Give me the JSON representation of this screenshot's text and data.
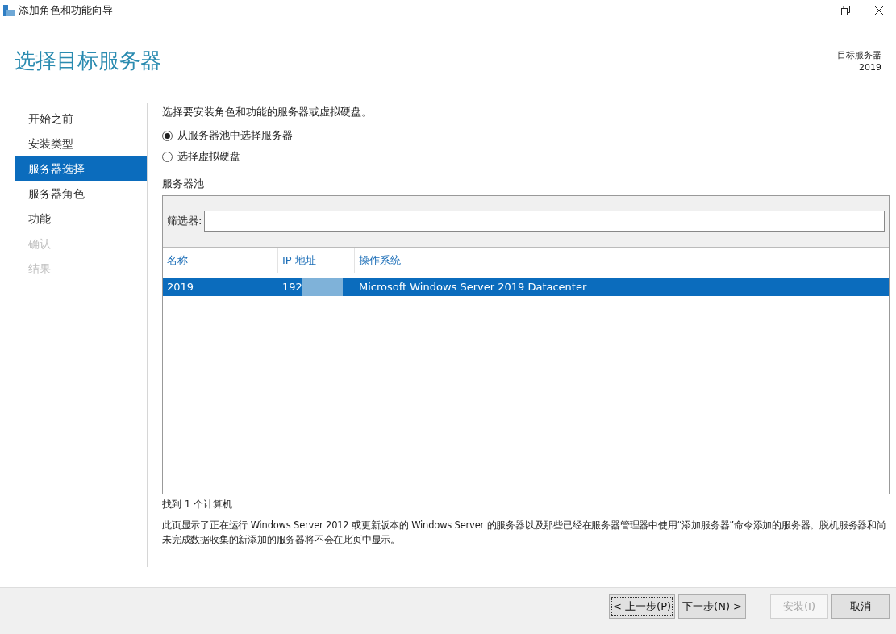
{
  "window": {
    "title": "添加角色和功能向导"
  },
  "header": {
    "title": "选择目标服务器",
    "target_label": "目标服务器",
    "target_value": "2019"
  },
  "sidebar": {
    "items": [
      {
        "label": "开始之前",
        "selected": false,
        "disabled": false
      },
      {
        "label": "安装类型",
        "selected": false,
        "disabled": false
      },
      {
        "label": "服务器选择",
        "selected": true,
        "disabled": false
      },
      {
        "label": "服务器角色",
        "selected": false,
        "disabled": false
      },
      {
        "label": "功能",
        "selected": false,
        "disabled": false
      },
      {
        "label": "确认",
        "selected": false,
        "disabled": true
      },
      {
        "label": "结果",
        "selected": false,
        "disabled": true
      }
    ]
  },
  "intro": "选择要安装角色和功能的服务器或虚拟硬盘。",
  "options": [
    {
      "label": "从服务器池中选择服务器",
      "selected": true
    },
    {
      "label": "选择虚拟硬盘",
      "selected": false
    }
  ],
  "pool": {
    "title": "服务器池",
    "filter_label": "筛选器:",
    "table": {
      "columns": [
        "名称",
        "IP 地址",
        "操作系统"
      ],
      "rows": [
        {
          "cells": [
            "2019",
            "192",
            "Microsoft Windows Server 2019 Datacenter"
          ],
          "selected": true,
          "ip_redacted": true
        }
      ]
    }
  },
  "count": "找到 1 个计算机",
  "note": "此页显示了正在运行 Windows Server 2012 或更新版本的 Windows Server 的服务器以及那些已经在服务器管理器中使用“添加服务器”命令添加的服务器。脱机服务器和尚未完成数据收集的新添加的服务器将不会在此页中显示。",
  "buttons": [
    {
      "label": "< 上一步(P)",
      "disabled": false,
      "focused": true
    },
    {
      "label": "下一步(N) >",
      "disabled": false,
      "focused": false
    },
    {
      "label": "安装(I)",
      "disabled": true,
      "focused": false
    },
    {
      "label": "取消",
      "disabled": false,
      "focused": false
    }
  ]
}
